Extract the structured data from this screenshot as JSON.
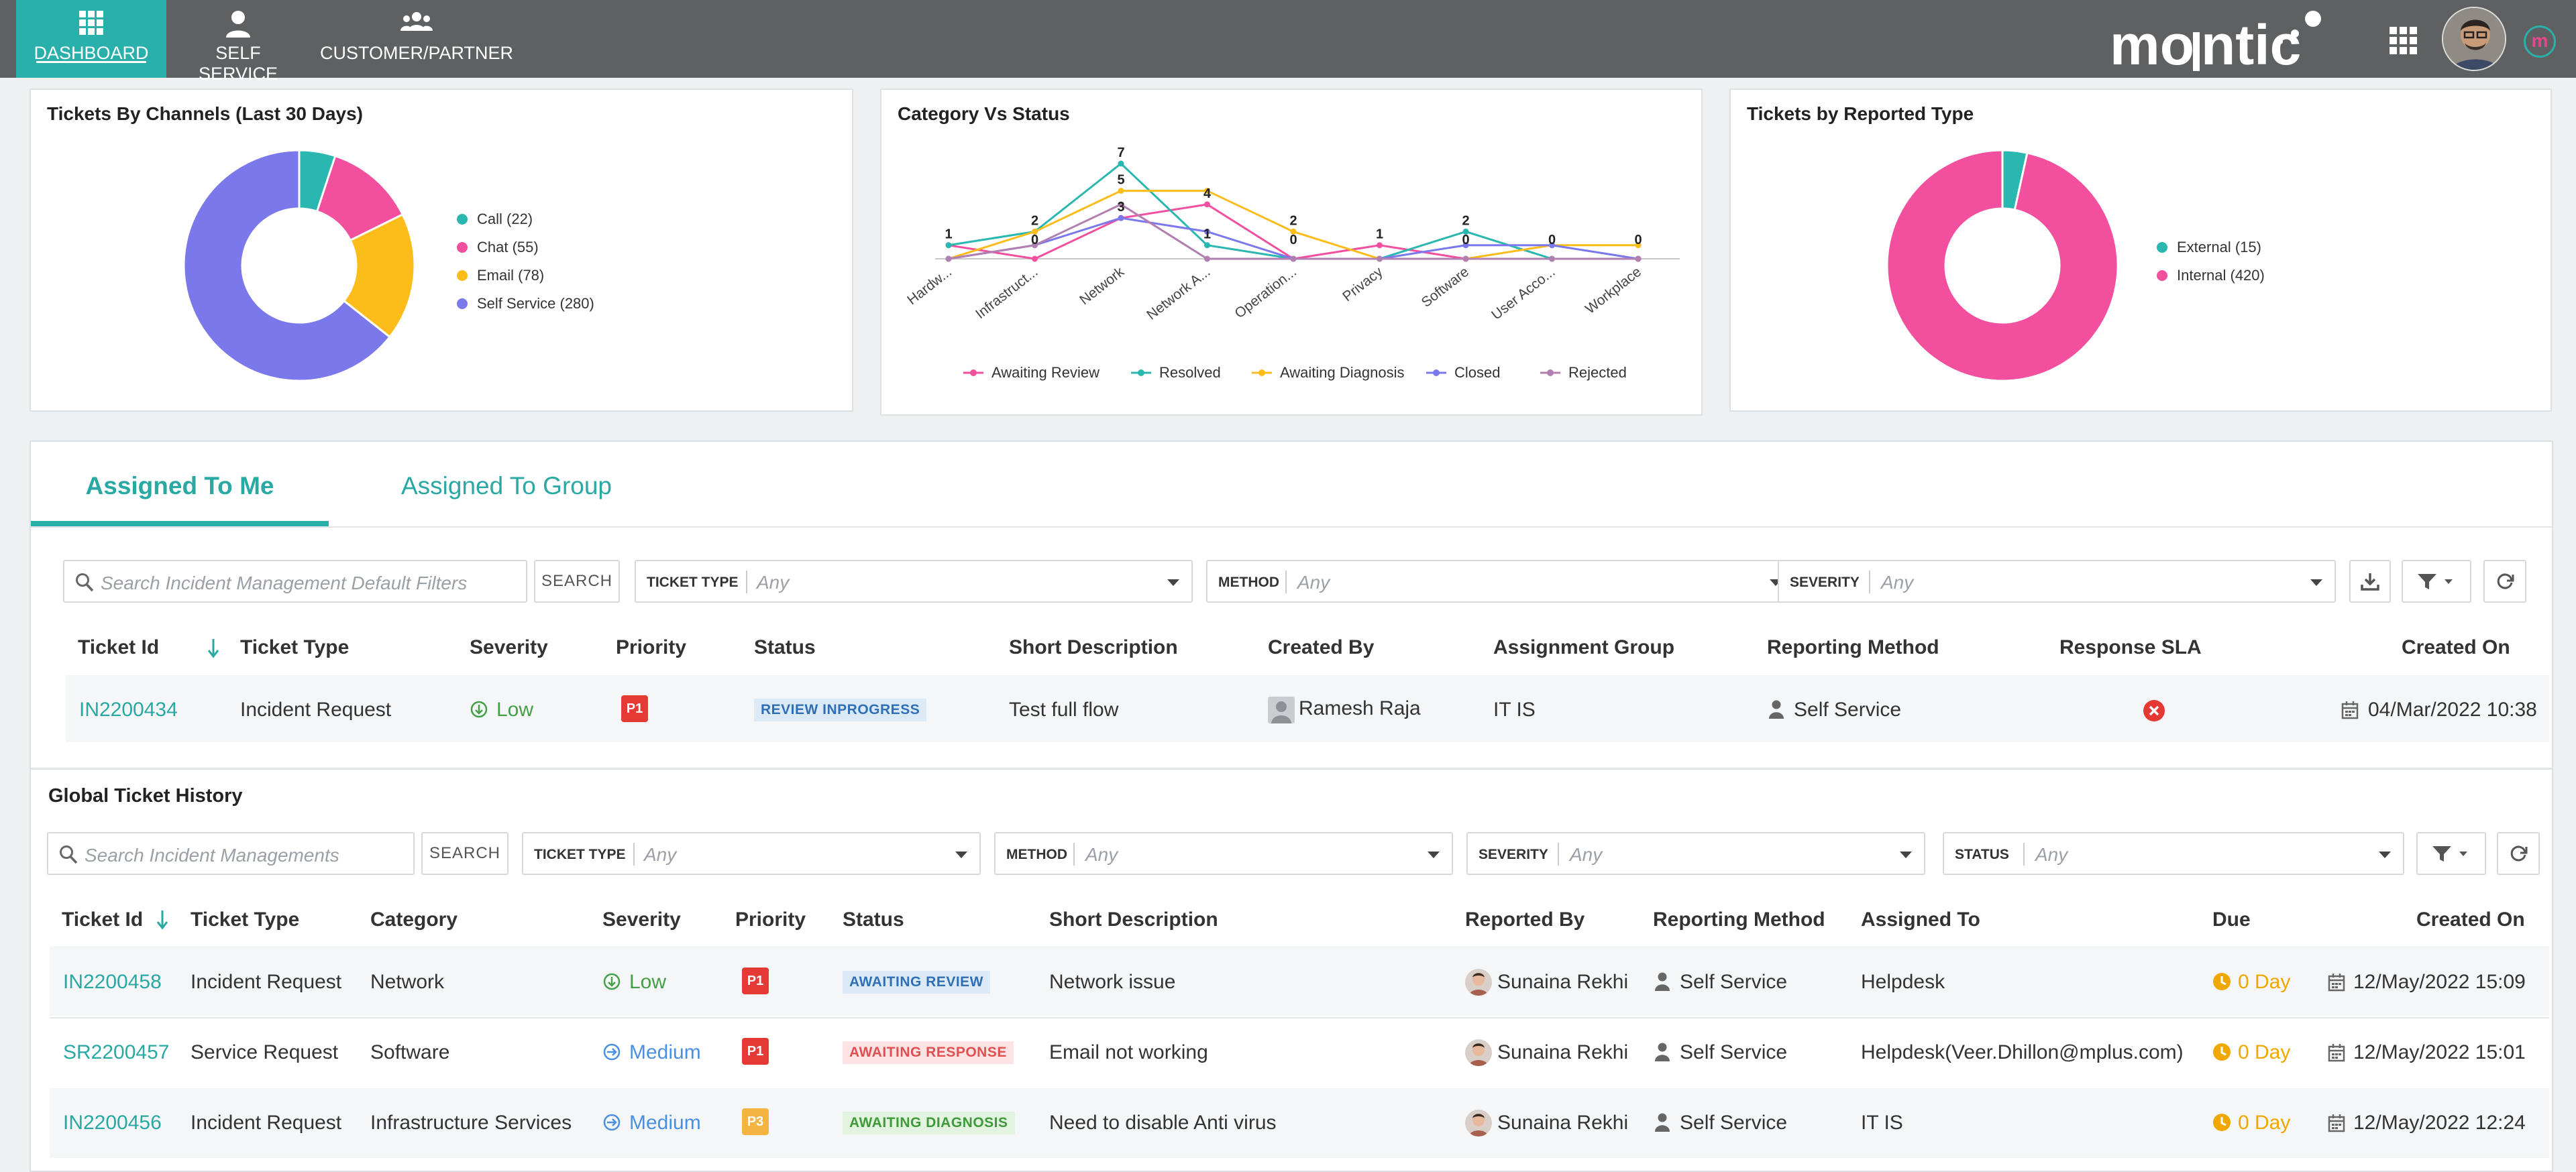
{
  "nav": {
    "items": [
      {
        "label": "DASHBOARD",
        "icon": "grid-icon"
      },
      {
        "label": "SELF SERVICE",
        "icon": "user-icon"
      },
      {
        "label": "CUSTOMER/PARTNER",
        "icon": "users-icon"
      }
    ],
    "logo": "motadata-logo",
    "badge": "m"
  },
  "colors": {
    "accent": "#2ab0ab",
    "call": "#2ab7b0",
    "chat": "#f24f9e",
    "email": "#fcbc1a",
    "self_service": "#7b78ec",
    "resolved": "#2ab7b0",
    "awaiting_review": "#f24f9e",
    "awaiting_diagnosis": "#fcbc1a",
    "closed": "#7b78ec",
    "rejected": "#b17fb0"
  },
  "cards": {
    "channels": {
      "title": "Tickets By Channels (Last 30 Days)"
    },
    "category": {
      "title": "Category Vs Status"
    },
    "reported": {
      "title": "Tickets by Reported Type"
    }
  },
  "chart_data": [
    {
      "type": "pie",
      "title": "Tickets By Channels (Last 30 Days)",
      "donut": true,
      "slices": [
        {
          "label": "Call (22)",
          "value": 22
        },
        {
          "label": "Chat (55)",
          "value": 55
        },
        {
          "label": "Email (78)",
          "value": 78
        },
        {
          "label": "Self Service (280)",
          "value": 280
        }
      ],
      "legend": "right"
    },
    {
      "type": "line",
      "title": "Category Vs Status",
      "categories": [
        "Hardw...",
        "Infrastruct...",
        "Network",
        "Network A...",
        "Operation...",
        "Privacy",
        "Software",
        "User Acco...",
        "Workplace"
      ],
      "series": [
        {
          "name": "Awaiting Review",
          "values": [
            1,
            0,
            3,
            4,
            0,
            1,
            0,
            0,
            0
          ]
        },
        {
          "name": "Resolved",
          "values": [
            1,
            2,
            7,
            1,
            0,
            0,
            2,
            0,
            0
          ]
        },
        {
          "name": "Awaiting Diagnosis",
          "values": [
            0,
            2,
            5,
            5,
            2,
            0,
            0,
            1,
            1
          ]
        },
        {
          "name": "Closed",
          "values": [
            0,
            1,
            3,
            2,
            0,
            0,
            1,
            1,
            0
          ]
        },
        {
          "name": "Rejected",
          "values": [
            0,
            1,
            4,
            0,
            0,
            0,
            0,
            0,
            0
          ]
        }
      ],
      "data_labels": [
        {
          "category": "Hardw...",
          "text": "1",
          "value": 1
        },
        {
          "category": "Infrastruct...",
          "text": "2",
          "value": 2
        },
        {
          "category": "Infrastruct...",
          "text": "0",
          "value": 0.6
        },
        {
          "category": "Network",
          "text": "7",
          "value": 7
        },
        {
          "category": "Network",
          "text": "5",
          "value": 5
        },
        {
          "category": "Network",
          "text": "3",
          "value": 3
        },
        {
          "category": "Network A...",
          "text": "4",
          "value": 4
        },
        {
          "category": "Network A...",
          "text": "1",
          "value": 1
        },
        {
          "category": "Operation...",
          "text": "2",
          "value": 2
        },
        {
          "category": "Operation...",
          "text": "0",
          "value": 0.6
        },
        {
          "category": "Privacy",
          "text": "1",
          "value": 1
        },
        {
          "category": "Software",
          "text": "2",
          "value": 2
        },
        {
          "category": "Software",
          "text": "0",
          "value": 0.6
        },
        {
          "category": "User Acco...",
          "text": "0",
          "value": 0.6
        },
        {
          "category": "Workplace",
          "text": "0",
          "value": 0.6
        }
      ],
      "ylim": [
        0,
        7
      ],
      "legend": "bottom"
    },
    {
      "type": "pie",
      "title": "Tickets by Reported Type",
      "donut": true,
      "slices": [
        {
          "label": "External (15)",
          "value": 15
        },
        {
          "label": "Internal (420)",
          "value": 420
        }
      ],
      "legend": "right"
    }
  ],
  "tabs": [
    {
      "label": "Assigned To Me",
      "active": true
    },
    {
      "label": "Assigned To Group",
      "active": false
    }
  ],
  "assigned": {
    "search_placeholder": "Search Incident Management Default Filters",
    "search_button": "SEARCH",
    "filters": [
      {
        "key": "TICKET TYPE",
        "value": "Any"
      },
      {
        "key": "METHOD",
        "value": "Any"
      },
      {
        "key": "SEVERITY",
        "value": "Any"
      }
    ],
    "columns": [
      "Ticket Id",
      "Ticket Type",
      "Severity",
      "Priority",
      "Status",
      "Short Description",
      "Created By",
      "Assignment Group",
      "Reporting Method",
      "Response SLA",
      "Created On"
    ],
    "rows": [
      {
        "id": "IN2200434",
        "type": "Incident Request",
        "severity": "Low",
        "priority": "P1",
        "status": "REVIEW INPROGRESS",
        "desc": "Test full flow",
        "created_by": "Ramesh Raja",
        "group": "IT IS",
        "method": "Self Service",
        "created_on": "04/Mar/2022 10:38"
      }
    ]
  },
  "history": {
    "title": "Global Ticket History",
    "search_placeholder": "Search Incident Managements",
    "search_button": "SEARCH",
    "filters": [
      {
        "key": "TICKET TYPE",
        "value": "Any"
      },
      {
        "key": "METHOD",
        "value": "Any"
      },
      {
        "key": "SEVERITY",
        "value": "Any"
      },
      {
        "key": "STATUS",
        "value": "Any"
      }
    ],
    "columns": [
      "Ticket Id",
      "Ticket Type",
      "Category",
      "Severity",
      "Priority",
      "Status",
      "Short Description",
      "Reported By",
      "Reporting Method",
      "Assigned To",
      "Due",
      "Created On"
    ],
    "rows": [
      {
        "id": "IN2200458",
        "type": "Incident Request",
        "category": "Network",
        "severity": "Low",
        "priority": "P1",
        "status": "AWAITING REVIEW",
        "desc": "Network issue",
        "reported_by": "Sunaina Rekhi",
        "method": "Self Service",
        "assigned_to": "Helpdesk",
        "due": "0 Day",
        "created_on": "12/May/2022 15:09"
      },
      {
        "id": "SR2200457",
        "type": "Service Request",
        "category": "Software",
        "severity": "Medium",
        "priority": "P1",
        "status": "AWAITING RESPONSE",
        "desc": "Email not working",
        "reported_by": "Sunaina Rekhi",
        "method": "Self Service",
        "assigned_to": "Helpdesk(Veer.Dhillon@mplus.com)",
        "due": "0 Day",
        "created_on": "12/May/2022 15:01"
      },
      {
        "id": "IN2200456",
        "type": "Incident Request",
        "category": "Infrastructure Services",
        "severity": "Medium",
        "priority": "P3",
        "status": "AWAITING DIAGNOSIS",
        "desc": "Need to disable Anti virus",
        "reported_by": "Sunaina Rekhi",
        "method": "Self Service",
        "assigned_to": "IT IS",
        "due": "0 Day",
        "created_on": "12/May/2022 12:24"
      }
    ]
  }
}
